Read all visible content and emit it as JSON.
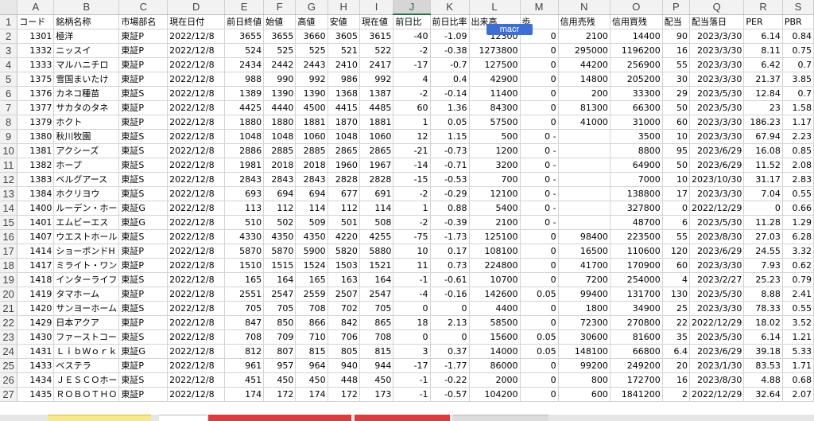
{
  "column_letters": [
    "A",
    "B",
    "C",
    "D",
    "E",
    "F",
    "G",
    "H",
    "I",
    "J",
    "K",
    "L",
    "M",
    "N",
    "O",
    "P",
    "Q",
    "R",
    "S"
  ],
  "selected_column": "J",
  "header_row": [
    "コード",
    "銘柄名称",
    "市場部名",
    "現在日付",
    "前日終値",
    "始値",
    "高値",
    "安値",
    "現在値",
    "前日比",
    "前日比率",
    "出来高",
    "歩",
    "信用売残",
    "信用買残",
    "配当",
    "配当落日",
    "PER",
    "PBR"
  ],
  "macro_tag": "macr",
  "rows": [
    [
      "1301",
      "極洋",
      "東証P",
      "2022/12/8",
      "3655",
      "3655",
      "3660",
      "3605",
      "3615",
      "-40",
      "-1.09",
      "12300",
      "0",
      "2100",
      "14400",
      "90",
      "2023/3/30",
      "6.14",
      "0.84"
    ],
    [
      "1332",
      "ニッスイ",
      "東証P",
      "2022/12/8",
      "524",
      "525",
      "525",
      "521",
      "522",
      "-2",
      "-0.38",
      "1273800",
      "0",
      "295000",
      "1196200",
      "16",
      "2023/3/30",
      "8.11",
      "0.75"
    ],
    [
      "1333",
      "マルハニチロ",
      "東証P",
      "2022/12/8",
      "2434",
      "2442",
      "2443",
      "2410",
      "2417",
      "-17",
      "-0.7",
      "127500",
      "0",
      "44200",
      "256900",
      "55",
      "2023/3/30",
      "6.42",
      "0.7"
    ],
    [
      "1375",
      "雪国まいたけ",
      "東証P",
      "2022/12/8",
      "988",
      "990",
      "992",
      "986",
      "992",
      "4",
      "0.4",
      "42900",
      "0",
      "14800",
      "205200",
      "30",
      "2023/3/30",
      "21.37",
      "3.85"
    ],
    [
      "1376",
      "カネコ種苗",
      "東証S",
      "2022/12/8",
      "1389",
      "1390",
      "1390",
      "1368",
      "1387",
      "-2",
      "-0.14",
      "11400",
      "0",
      "200",
      "33300",
      "29",
      "2023/5/30",
      "12.84",
      "0.7"
    ],
    [
      "1377",
      "サカタのタネ",
      "東証P",
      "2022/12/8",
      "4425",
      "4440",
      "4500",
      "4415",
      "4485",
      "60",
      "1.36",
      "84300",
      "0",
      "81300",
      "66300",
      "50",
      "2023/5/30",
      "23",
      "1.58"
    ],
    [
      "1379",
      "ホクト",
      "東証P",
      "2022/12/8",
      "1880",
      "1880",
      "1881",
      "1870",
      "1881",
      "1",
      "0.05",
      "57500",
      "0",
      "41000",
      "31000",
      "60",
      "2023/3/30",
      "186.23",
      "1.17"
    ],
    [
      "1380",
      "秋川牧園",
      "東証S",
      "2022/12/8",
      "1048",
      "1048",
      "1060",
      "1048",
      "1060",
      "12",
      "1.15",
      "500",
      "0 -",
      "",
      "3500",
      "10",
      "2023/3/30",
      "67.94",
      "2.23"
    ],
    [
      "1381",
      "アクシーズ",
      "東証S",
      "2022/12/8",
      "2886",
      "2885",
      "2885",
      "2865",
      "2865",
      "-21",
      "-0.73",
      "1200",
      "0 -",
      "",
      "8800",
      "95",
      "2023/6/29",
      "16.08",
      "0.85"
    ],
    [
      "1382",
      "ホープ",
      "東証S",
      "2022/12/8",
      "1981",
      "2018",
      "2018",
      "1960",
      "1967",
      "-14",
      "-0.71",
      "3200",
      "0 -",
      "",
      "64900",
      "50",
      "2023/6/29",
      "11.52",
      "2.08"
    ],
    [
      "1383",
      "ベルグアース",
      "東証S",
      "2022/12/8",
      "2843",
      "2843",
      "2843",
      "2828",
      "2828",
      "-15",
      "-0.53",
      "700",
      "0 -",
      "",
      "7000",
      "10",
      "2023/10/30",
      "31.17",
      "2.83"
    ],
    [
      "1384",
      "ホクリヨウ",
      "東証S",
      "2022/12/8",
      "693",
      "694",
      "694",
      "677",
      "691",
      "-2",
      "-0.29",
      "12100",
      "0 -",
      "",
      "138800",
      "17",
      "2023/3/30",
      "7.04",
      "0.55"
    ],
    [
      "1400",
      "ルーデン・ホー",
      "東証G",
      "2022/12/8",
      "113",
      "112",
      "114",
      "112",
      "114",
      "1",
      "0.88",
      "5400",
      "0 -",
      "",
      "327800",
      "0",
      "2022/12/29",
      "0",
      "0.66"
    ],
    [
      "1401",
      "エムビーエス",
      "東証G",
      "2022/12/8",
      "510",
      "502",
      "509",
      "501",
      "508",
      "-2",
      "-0.39",
      "2100",
      "0 -",
      "",
      "48700",
      "6",
      "2023/5/30",
      "11.28",
      "1.29"
    ],
    [
      "1407",
      "ウエストホール",
      "東証S",
      "2022/12/8",
      "4330",
      "4350",
      "4350",
      "4220",
      "4255",
      "-75",
      "-1.73",
      "125100",
      "0",
      "98400",
      "223500",
      "55",
      "2023/8/30",
      "27.03",
      "6.28"
    ],
    [
      "1414",
      "ショーボンドH",
      "東証P",
      "2022/12/8",
      "5870",
      "5870",
      "5900",
      "5820",
      "5880",
      "10",
      "0.17",
      "108100",
      "0",
      "16500",
      "110600",
      "120",
      "2023/6/29",
      "24.55",
      "3.32"
    ],
    [
      "1417",
      "ミライト・ワン",
      "東証P",
      "2022/12/8",
      "1510",
      "1515",
      "1524",
      "1503",
      "1521",
      "11",
      "0.73",
      "224800",
      "0",
      "41700",
      "170900",
      "60",
      "2023/3/30",
      "7.93",
      "0.62"
    ],
    [
      "1418",
      "インターライフ",
      "東証S",
      "2022/12/8",
      "165",
      "164",
      "165",
      "163",
      "164",
      "-1",
      "-0.61",
      "10700",
      "0",
      "7200",
      "254000",
      "4",
      "2023/2/27",
      "25.23",
      "0.79"
    ],
    [
      "1419",
      "タマホーム",
      "東証P",
      "2022/12/8",
      "2551",
      "2547",
      "2559",
      "2507",
      "2547",
      "-4",
      "-0.16",
      "142600",
      "0.05",
      "99400",
      "131700",
      "130",
      "2023/5/30",
      "8.88",
      "2.41"
    ],
    [
      "1420",
      "サンヨーホーム",
      "東証S",
      "2022/12/8",
      "705",
      "705",
      "708",
      "702",
      "705",
      "0",
      "0",
      "4400",
      "0",
      "1800",
      "34900",
      "25",
      "2023/3/30",
      "78.33",
      "0.55"
    ],
    [
      "1429",
      "日本アクア",
      "東証P",
      "2022/12/8",
      "847",
      "850",
      "866",
      "842",
      "865",
      "18",
      "2.13",
      "58500",
      "0",
      "72300",
      "270800",
      "22",
      "2022/12/29",
      "18.02",
      "3.52"
    ],
    [
      "1430",
      "ファーストコー",
      "東証S",
      "2022/12/8",
      "708",
      "709",
      "710",
      "706",
      "708",
      "0",
      "0",
      "15600",
      "0.05",
      "30600",
      "81600",
      "35",
      "2023/5/30",
      "6.14",
      "1.21"
    ],
    [
      "1431",
      "ＬｉｂＷｏｒｋ",
      "東証G",
      "2022/12/8",
      "812",
      "807",
      "815",
      "805",
      "815",
      "3",
      "0.37",
      "14000",
      "0.05",
      "148100",
      "66800",
      "6.4",
      "2023/6/29",
      "39.18",
      "5.33"
    ],
    [
      "1433",
      "ベステラ",
      "東証P",
      "2022/12/8",
      "961",
      "957",
      "964",
      "940",
      "944",
      "-17",
      "-1.77",
      "86000",
      "0",
      "99200",
      "249200",
      "20",
      "2023/1/30",
      "83.53",
      "1.71"
    ],
    [
      "1434",
      "ＪＥＳＣＯホー",
      "東証S",
      "2022/12/8",
      "451",
      "450",
      "450",
      "448",
      "450",
      "-1",
      "-0.22",
      "2000",
      "0",
      "800",
      "172700",
      "16",
      "2023/8/30",
      "4.88",
      "0.68"
    ],
    [
      "1435",
      "ＲＯＢＯＴＨＯ",
      "東証P",
      "2022/12/8",
      "174",
      "172",
      "174",
      "172",
      "173",
      "-1",
      "-0.57",
      "104200",
      "0",
      "600",
      "1841200",
      "2",
      "2022/12/29",
      "32.64",
      "2.07"
    ]
  ]
}
